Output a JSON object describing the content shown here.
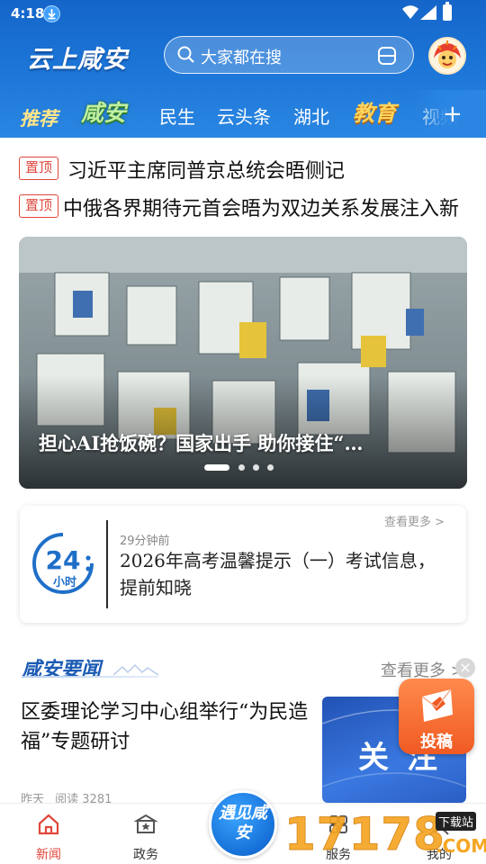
{
  "status_bar": {
    "time": "4:18"
  },
  "header": {
    "logo_text": "云上咸安",
    "search_placeholder": "大家都在搜"
  },
  "tabs": [
    {
      "label": "推荐",
      "style": "stylized"
    },
    {
      "label": "咸安",
      "style": "stylized"
    },
    {
      "label": "民生"
    },
    {
      "label": "云头条"
    },
    {
      "label": "湖北"
    },
    {
      "label": "教育",
      "style": "stylized"
    },
    {
      "label": "视频"
    }
  ],
  "pinned": [
    {
      "badge": "置顶",
      "title": "习近平主席同普京总统会晤侧记"
    },
    {
      "badge": "置顶",
      "title": "中俄各界期待元首会晤为双边关系发展注入新"
    }
  ],
  "banner": {
    "caption": "担心AI抢饭碗？国家出手 助你接住“…",
    "slides": 4,
    "active_slide": 0
  },
  "news24": {
    "more": "查看更多 >",
    "time": "29分钟前",
    "title": "2026年高考温馨提示（一）考试信息，提前知晓",
    "logo_number": "24",
    "logo_unit": "小时"
  },
  "section": {
    "title": "咸安要闻",
    "more": "查看更多 >",
    "article": {
      "title": "区委理论学习中心组举行“为民造福”专题研讨",
      "date": "昨天",
      "reads": "阅读 3281",
      "thumb_text": "关注"
    }
  },
  "submit_fab": {
    "label": "投稿"
  },
  "bottom_nav": {
    "items": [
      {
        "label": "新闻",
        "active": true
      },
      {
        "label": "政务"
      },
      {
        "label": "服务"
      },
      {
        "label": "我的"
      }
    ],
    "center_label": "遇见咸安"
  },
  "watermark": {
    "digits": "17178",
    "com": ".COM",
    "tag": "下载站"
  },
  "colors": {
    "header_blue": "#1b74d6",
    "accent_red": "#e0463b",
    "section_blue": "#1b5bb3",
    "fab_orange": "#f05a22"
  }
}
